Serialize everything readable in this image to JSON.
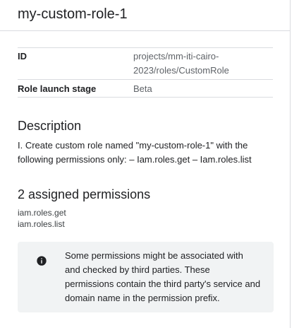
{
  "header": {
    "title": "my-custom-role-1"
  },
  "details": {
    "rows": [
      {
        "key": "ID",
        "value": "projects/mm-iti-cairo-2023/roles/CustomRole"
      },
      {
        "key": "Role launch stage",
        "value": "Beta"
      }
    ]
  },
  "description": {
    "title": "Description",
    "text": "I. Create custom role named \"my-custom-role-1\" with the following permissions only: – Iam.roles.get – Iam.roles.list"
  },
  "permissions": {
    "title": "2 assigned permissions",
    "items": [
      "iam.roles.get",
      "iam.roles.list"
    ]
  },
  "notice": {
    "icon": "info-icon",
    "text": "Some permissions might be associated with and checked by third parties. These permissions contain the third party's service and domain name in the permission prefix."
  }
}
